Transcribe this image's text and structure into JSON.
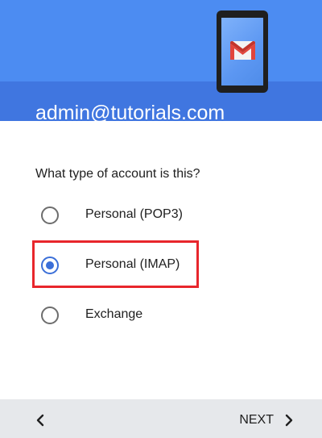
{
  "header": {
    "email": "admin@tutorials.com",
    "illustration_icon": "gmail-phone-icon"
  },
  "question": "What type of account is this?",
  "options": [
    {
      "label": "Personal (POP3)",
      "selected": false
    },
    {
      "label": "Personal (IMAP)",
      "selected": true
    },
    {
      "label": "Exchange",
      "selected": false
    }
  ],
  "footer": {
    "back_icon": "chevron-left-icon",
    "next_label": "NEXT",
    "next_icon": "chevron-right-icon"
  },
  "colors": {
    "header_top": "#4c8cf2",
    "header_bottom": "#4076e0",
    "radio_selected": "#3b6fd8",
    "highlight_border": "#e8262c",
    "footer_bg": "#e6e8eb"
  }
}
